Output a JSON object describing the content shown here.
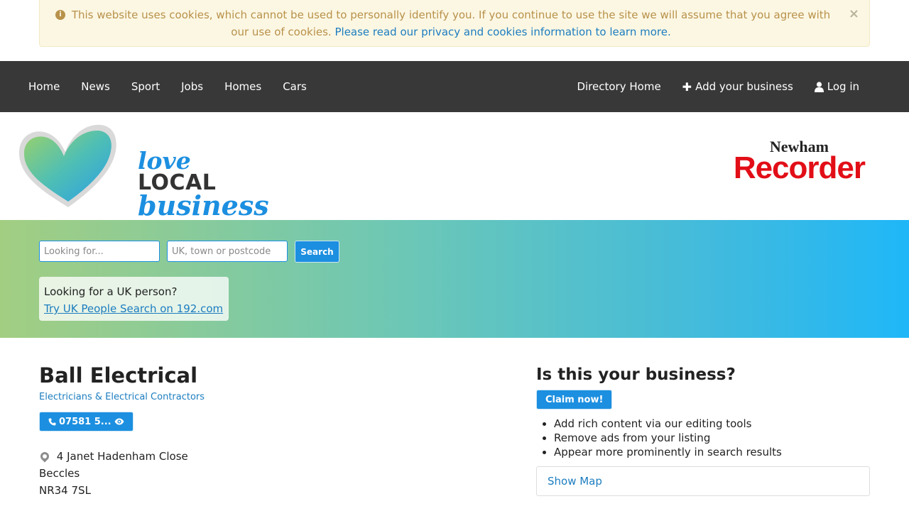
{
  "cookie_banner": {
    "message": "This website uses cookies, which cannot be used to personally identify you. If you continue to use the site we will assume that you agree with our use of cookies.",
    "link": "Please read our privacy and cookies information to learn more.",
    "close": "×"
  },
  "nav": {
    "left": [
      "Home",
      "News",
      "Sport",
      "Jobs",
      "Homes",
      "Cars"
    ],
    "directory_home": "Directory Home",
    "add_business": "Add your business",
    "log_in": "Log in"
  },
  "brand": {
    "logo_love": "love",
    "logo_local": "LOCAL",
    "logo_business": "business",
    "recorder_top": "Newham",
    "recorder_main": "Recorder"
  },
  "search": {
    "what_placeholder": "Looking for...",
    "where_placeholder": "UK, town or postcode",
    "button": "Search",
    "people_question": "Looking for a UK person?",
    "people_link": "Try UK People Search on 192.com"
  },
  "listing": {
    "name": "Ball Electrical",
    "category": "Electricians & Electrical Contractors",
    "phone": "07581 5...",
    "address": [
      "4 Janet Hadenham Close",
      "Beccles",
      "NR34 7SL"
    ]
  },
  "claim": {
    "title": "Is this your business?",
    "button": "Claim now!",
    "benefits": [
      "Add rich content via our editing tools",
      "Remove ads from your listing",
      "Appear more prominently in search results"
    ],
    "show_map": "Show Map"
  },
  "colors": {
    "accent": "#1c8fe0",
    "navbar": "#383838",
    "recorder_red": "#e20e17",
    "banner_bg": "#fcf7e3"
  },
  "icons": {
    "info": "info-circle-icon",
    "phone": "phone-icon",
    "eye": "eye-icon",
    "plus": "plus-icon",
    "user": "user-icon",
    "pin": "map-marker-icon"
  }
}
